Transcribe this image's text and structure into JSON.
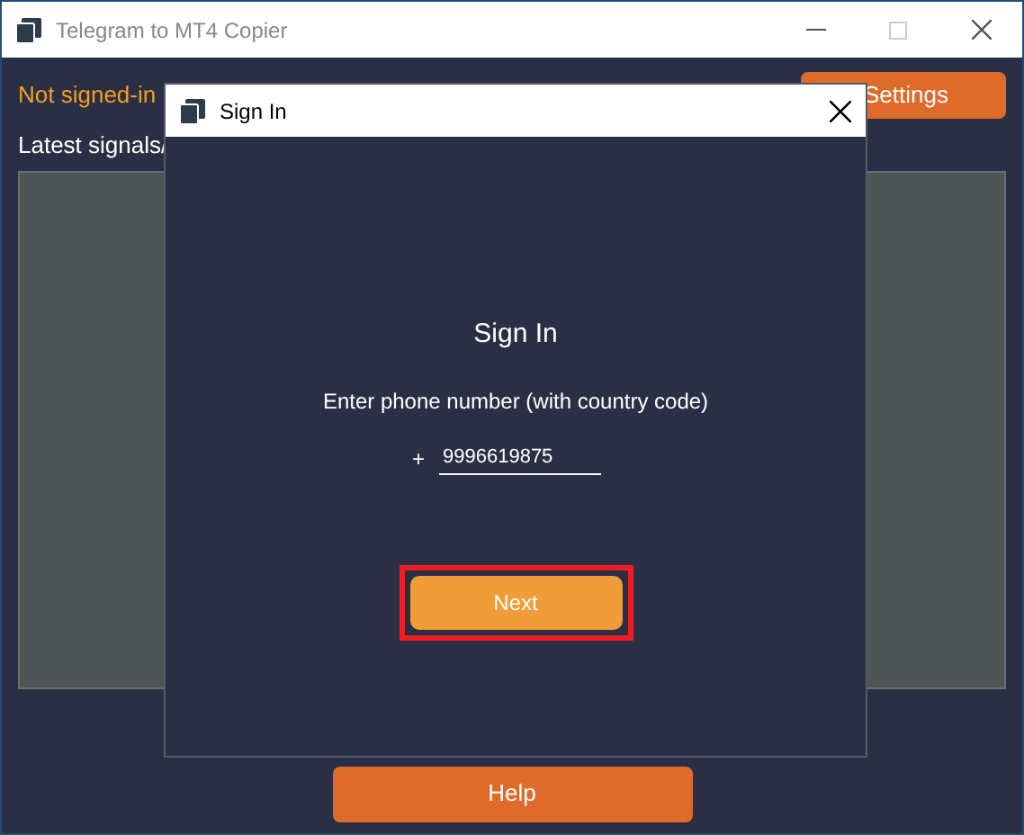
{
  "window": {
    "title": "Telegram to MT4 Copier"
  },
  "status": "Not signed-in",
  "settings_button": "Settings",
  "signals_label": "Latest signals/",
  "help_button": "Help",
  "dialog": {
    "title": "Sign In",
    "heading": "Sign In",
    "prompt": "Enter phone number (with country code)",
    "prefix": "+",
    "phone": {
      "value": "9996619875"
    },
    "next_button": {
      "label": "Next",
      "highlighted": true
    }
  }
}
